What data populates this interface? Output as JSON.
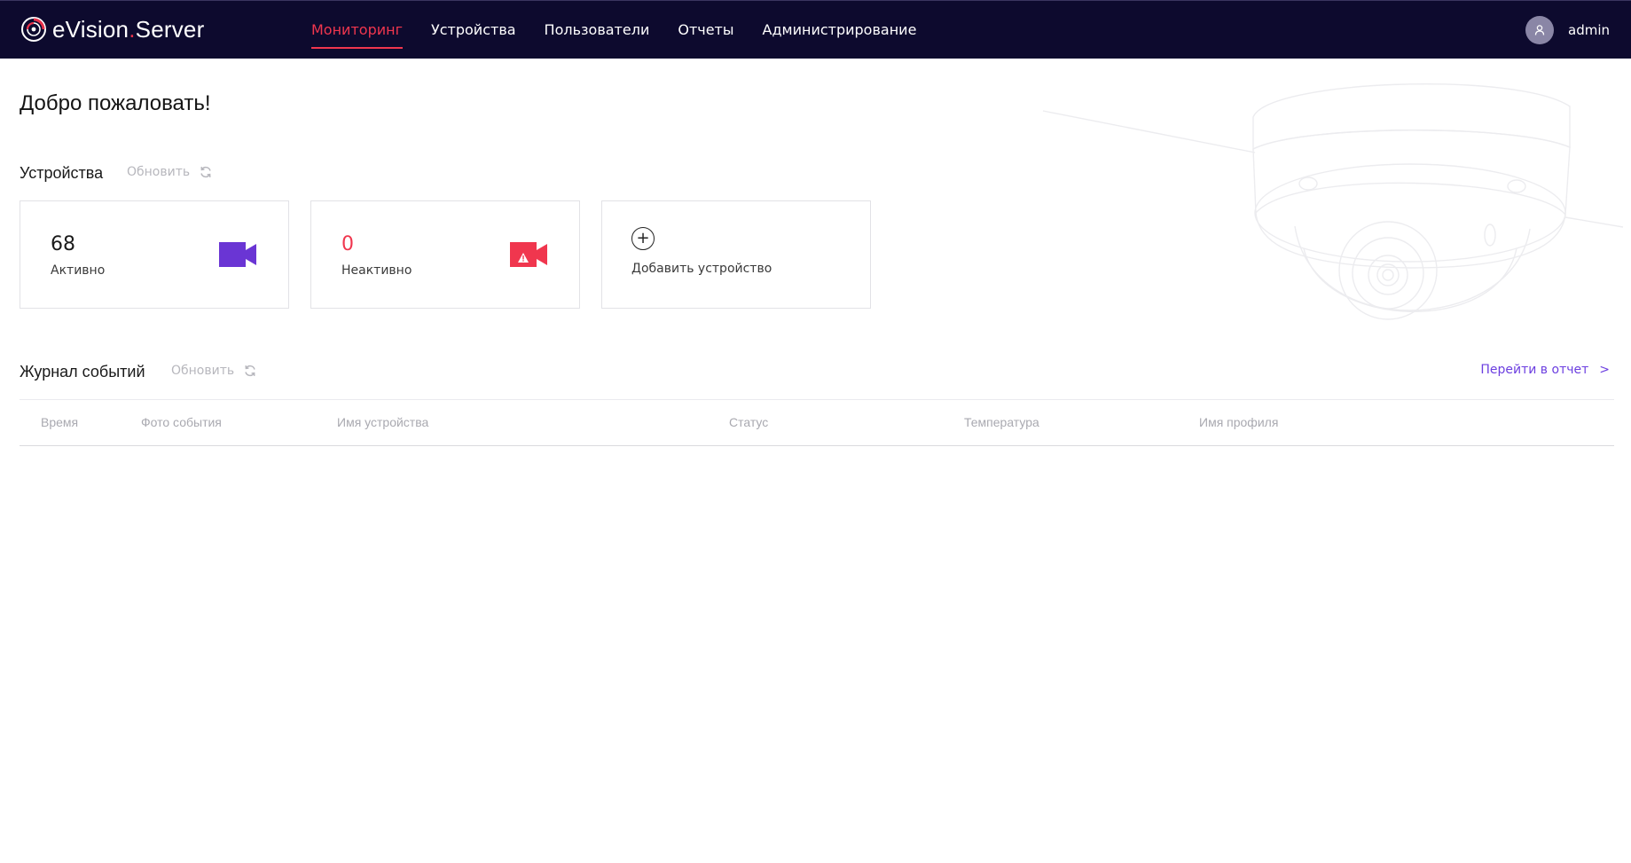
{
  "header": {
    "brand_prefix": "eVision",
    "brand_dot": ".",
    "brand_suffix": "Server",
    "nav": [
      {
        "label": "Мониторинг",
        "active": true
      },
      {
        "label": "Устройства",
        "active": false
      },
      {
        "label": "Пользователи",
        "active": false
      },
      {
        "label": "Отчеты",
        "active": false
      },
      {
        "label": "Администрирование",
        "active": false
      }
    ],
    "user_name": "admin"
  },
  "welcome": "Добро пожаловать!",
  "devices": {
    "title": "Устройства",
    "refresh_label": "Обновить",
    "active": {
      "count": "68",
      "label": "Активно"
    },
    "inactive": {
      "count": "0",
      "label": "Неактивно"
    },
    "add_label": "Добавить устройство"
  },
  "events": {
    "title": "Журнал событий",
    "refresh_label": "Обновить",
    "report_link": "Перейти в отчет",
    "report_chevron": ">",
    "columns": [
      "Время",
      "Фото события",
      "Имя устройства",
      "Статус",
      "Температура",
      "Имя профиля"
    ]
  },
  "colors": {
    "header_bg": "#0d0a2e",
    "accent_red": "#f0364e",
    "accent_purple": "#6c3fe0"
  },
  "icons": {
    "refresh": "refresh-icon",
    "active_camera": "video-camera-icon",
    "inactive_camera": "video-camera-warning-icon",
    "add": "plus-circle-icon",
    "avatar": "user-icon"
  }
}
